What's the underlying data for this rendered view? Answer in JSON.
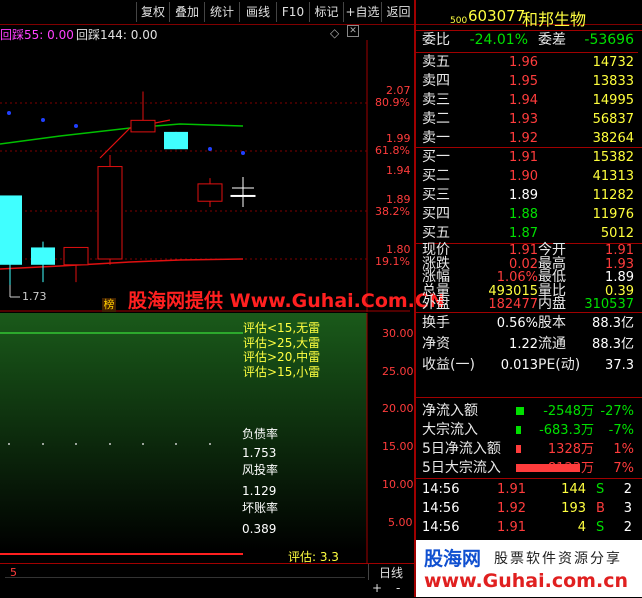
{
  "toolbar": [
    "复权",
    "叠加",
    "统计",
    "画线",
    "F10",
    "标记",
    "+自选",
    "返回"
  ],
  "indicator_header": {
    "left": "回踩55: 0.00",
    "right": "回踩144: 0.00"
  },
  "price_axis": [
    {
      "price": "2.07",
      "pct": "80.9%"
    },
    {
      "price": "1.99",
      "pct": "61.8%"
    },
    {
      "price": "1.94",
      "pct": ""
    },
    {
      "price": "1.89",
      "pct": "38.2%"
    },
    {
      "price": "1.80",
      "pct": "19.1%"
    }
  ],
  "low_label": "1.73",
  "badge": "榜",
  "watermark_main": "股海网提供 Www.Guhai.Com.CN",
  "lower_axis": [
    "30.00",
    "25.00",
    "20.00",
    "15.00",
    "10.00",
    "5.00"
  ],
  "legend": [
    "评估<15,无雷",
    "评估>25,大雷",
    "评估>20,中雷",
    "评估>15,小雷"
  ],
  "metrics": [
    {
      "label": "负债率",
      "value": "1.753"
    },
    {
      "label": "风投率",
      "value": "1.129"
    },
    {
      "label": "坏账率",
      "value": "0.389"
    }
  ],
  "score": "评估: 3.3",
  "bottom_left": "5",
  "period": "日线",
  "stock": {
    "code": "603077",
    "name": "和邦生物",
    "market": "500"
  },
  "weibi": {
    "label": "委比",
    "value": "-24.01%",
    "label2": "委差",
    "value2": "-53696"
  },
  "sells": [
    {
      "label": "卖五",
      "price": "1.96",
      "vol": "14732"
    },
    {
      "label": "卖四",
      "price": "1.95",
      "vol": "13833"
    },
    {
      "label": "卖三",
      "price": "1.94",
      "vol": "14995"
    },
    {
      "label": "卖二",
      "price": "1.93",
      "vol": "56837"
    },
    {
      "label": "卖一",
      "price": "1.92",
      "vol": "38264"
    }
  ],
  "buys": [
    {
      "label": "买一",
      "price": "1.91",
      "vol": "15382"
    },
    {
      "label": "买二",
      "price": "1.90",
      "vol": "41313"
    },
    {
      "label": "买三",
      "price": "1.89",
      "vol": "11282"
    },
    {
      "label": "买四",
      "price": "1.88",
      "vol": "11976"
    },
    {
      "label": "买五",
      "price": "1.87",
      "vol": "5012"
    }
  ],
  "quote": [
    {
      "l1": "现价",
      "v1": "1.91",
      "l2": "今开",
      "v2": "1.91"
    },
    {
      "l1": "涨跌",
      "v1": "0.02",
      "l2": "最高",
      "v2": "1.93"
    },
    {
      "l1": "涨幅",
      "v1": "1.06%",
      "l2": "最低",
      "v2": "1.89"
    },
    {
      "l1": "总量",
      "v1": "493015",
      "l2": "量比",
      "v2": "0.39"
    },
    {
      "l1": "外盘",
      "v1": "182477",
      "l2": "内盘",
      "v2": "310537"
    }
  ],
  "fund": [
    {
      "l1": "换手",
      "v1": "0.56%",
      "l2": "股本",
      "v2": "88.3亿"
    },
    {
      "l1": "净资",
      "v1": "1.22",
      "l2": "流通",
      "v2": "88.3亿"
    },
    {
      "l1": "收益(一)",
      "v1": "0.013",
      "l2": "PE(动)",
      "v2": "37.3"
    }
  ],
  "flows": [
    {
      "label": "净流入额",
      "value": "-2548万",
      "pct": "-27%",
      "bar_pct": 5
    },
    {
      "label": "大宗流入",
      "value": "-683.3万",
      "pct": "-7%",
      "bar_pct": 3
    },
    {
      "label": "5日净流入额",
      "value": "1328万",
      "pct": "1%",
      "bar_pct": 3
    },
    {
      "label": "5日大宗流入",
      "value": "8123万",
      "pct": "7%",
      "bar_pct": 40
    }
  ],
  "ticks": [
    {
      "time": "14:56",
      "price": "1.91",
      "vol": "144",
      "side": "S",
      "n": "2"
    },
    {
      "time": "14:56",
      "price": "1.92",
      "vol": "193",
      "side": "B",
      "n": "3"
    },
    {
      "time": "14:56",
      "price": "1.91",
      "vol": "4",
      "side": "S",
      "n": "2"
    }
  ],
  "footer_logo": "股海网",
  "footer_slogan": "股票软件资源分享",
  "footer_url": "www.Guhai.com.cn",
  "chart_data": {
    "type": "candlestick",
    "candles": [
      {
        "open": 1.91,
        "close": 1.79,
        "high": 1.91,
        "low": 1.75
      },
      {
        "open": 1.82,
        "close": 1.79,
        "high": 1.83,
        "low": 1.76
      },
      {
        "open": 1.79,
        "close": 1.82,
        "high": 1.82,
        "low": 1.76
      },
      {
        "open": 1.8,
        "close": 1.96,
        "high": 1.98,
        "low": 1.79
      },
      {
        "open": 2.02,
        "close": 2.04,
        "high": 2.09,
        "low": 2.02
      },
      {
        "open": 2.02,
        "close": 1.99,
        "high": 2.02,
        "low": 1.99
      },
      {
        "open": 1.9,
        "close": 1.93,
        "high": 1.94,
        "low": 1.89
      },
      {
        "open": 1.91,
        "close": 1.91,
        "high": 1.93,
        "low": 1.89
      }
    ]
  }
}
